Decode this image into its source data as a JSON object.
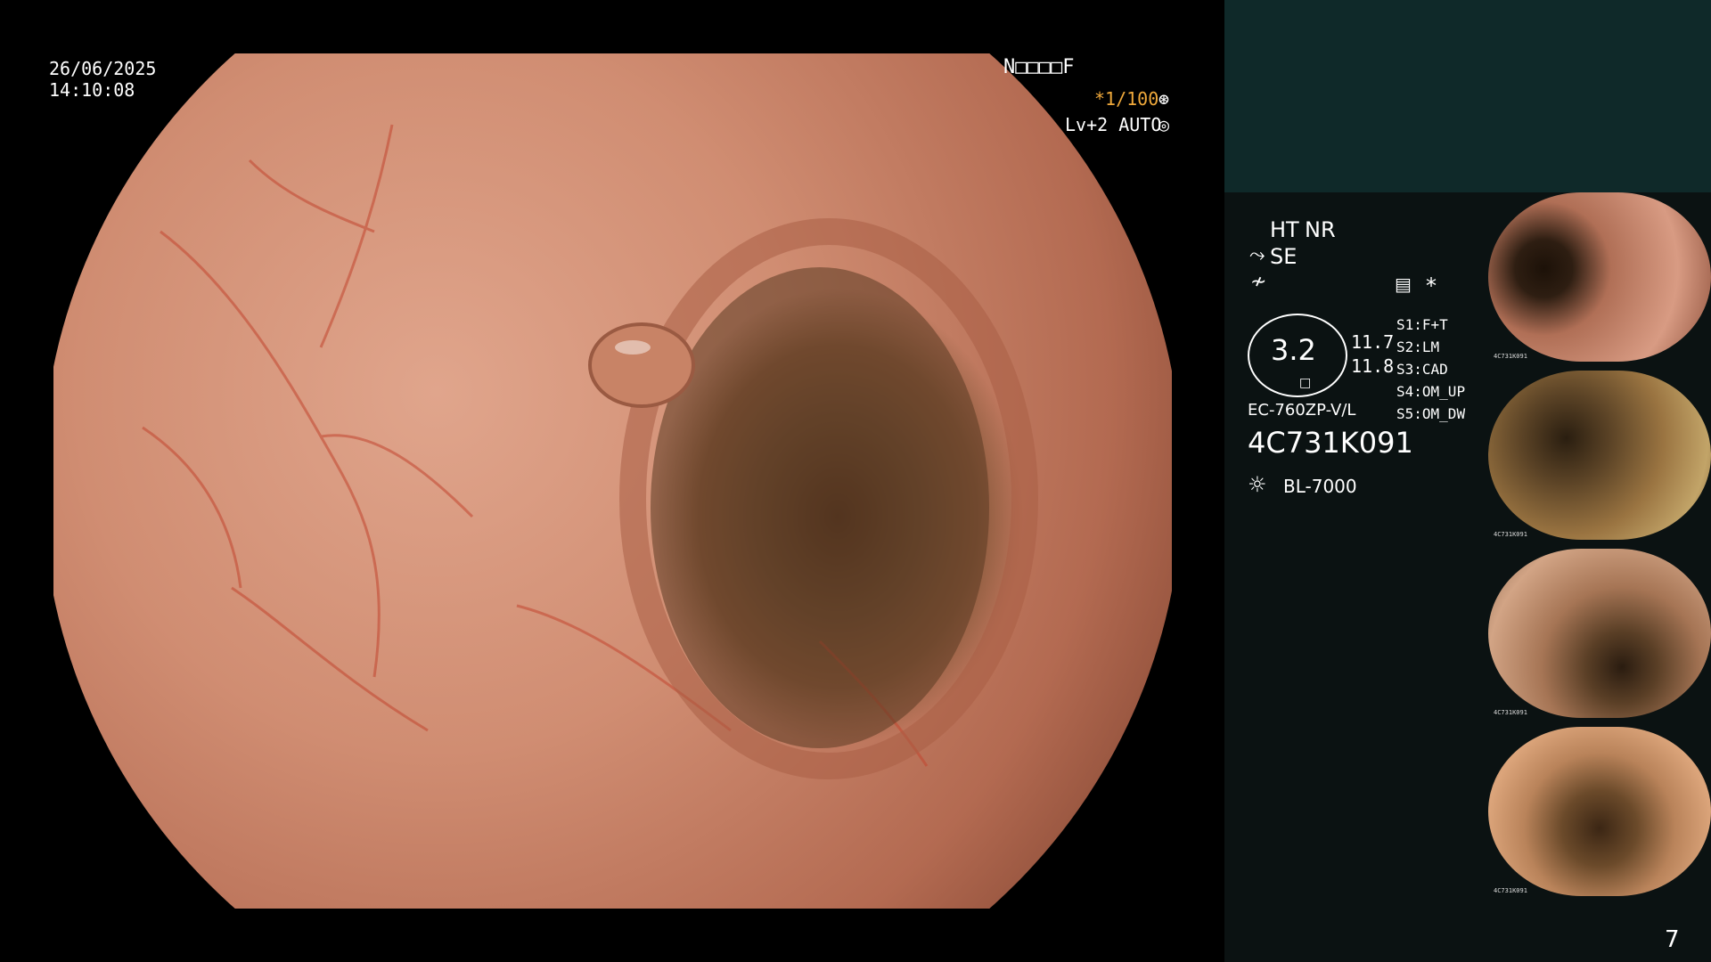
{
  "overlay": {
    "date": "26/06/2025",
    "time": "14:10:08",
    "status_code": "N□□□□F",
    "shutter": "*1/100",
    "level": "Lv+2 AUTO"
  },
  "panel": {
    "ht": "HT",
    "nr": "NR",
    "se": "SE",
    "asterisk": "*",
    "scope_value": "3.2",
    "value_a": "11.7",
    "value_b": "11.8",
    "scope_model": "EC-760ZP-V/L",
    "serial": "4C731K091",
    "light_source": "BL-7000",
    "switches": [
      {
        "key": "S1",
        "value": "F+T"
      },
      {
        "key": "S2",
        "value": "LM"
      },
      {
        "key": "S3",
        "value": "CAD"
      },
      {
        "key": "S4",
        "value": "OM_UP"
      },
      {
        "key": "S5",
        "value": "OM_DW"
      }
    ],
    "page_number": "7"
  },
  "thumbnails": [
    {
      "serial": "4C731K091"
    },
    {
      "serial": "4C731K091"
    },
    {
      "serial": "4C731K091"
    },
    {
      "serial": "4C731K091"
    }
  ]
}
